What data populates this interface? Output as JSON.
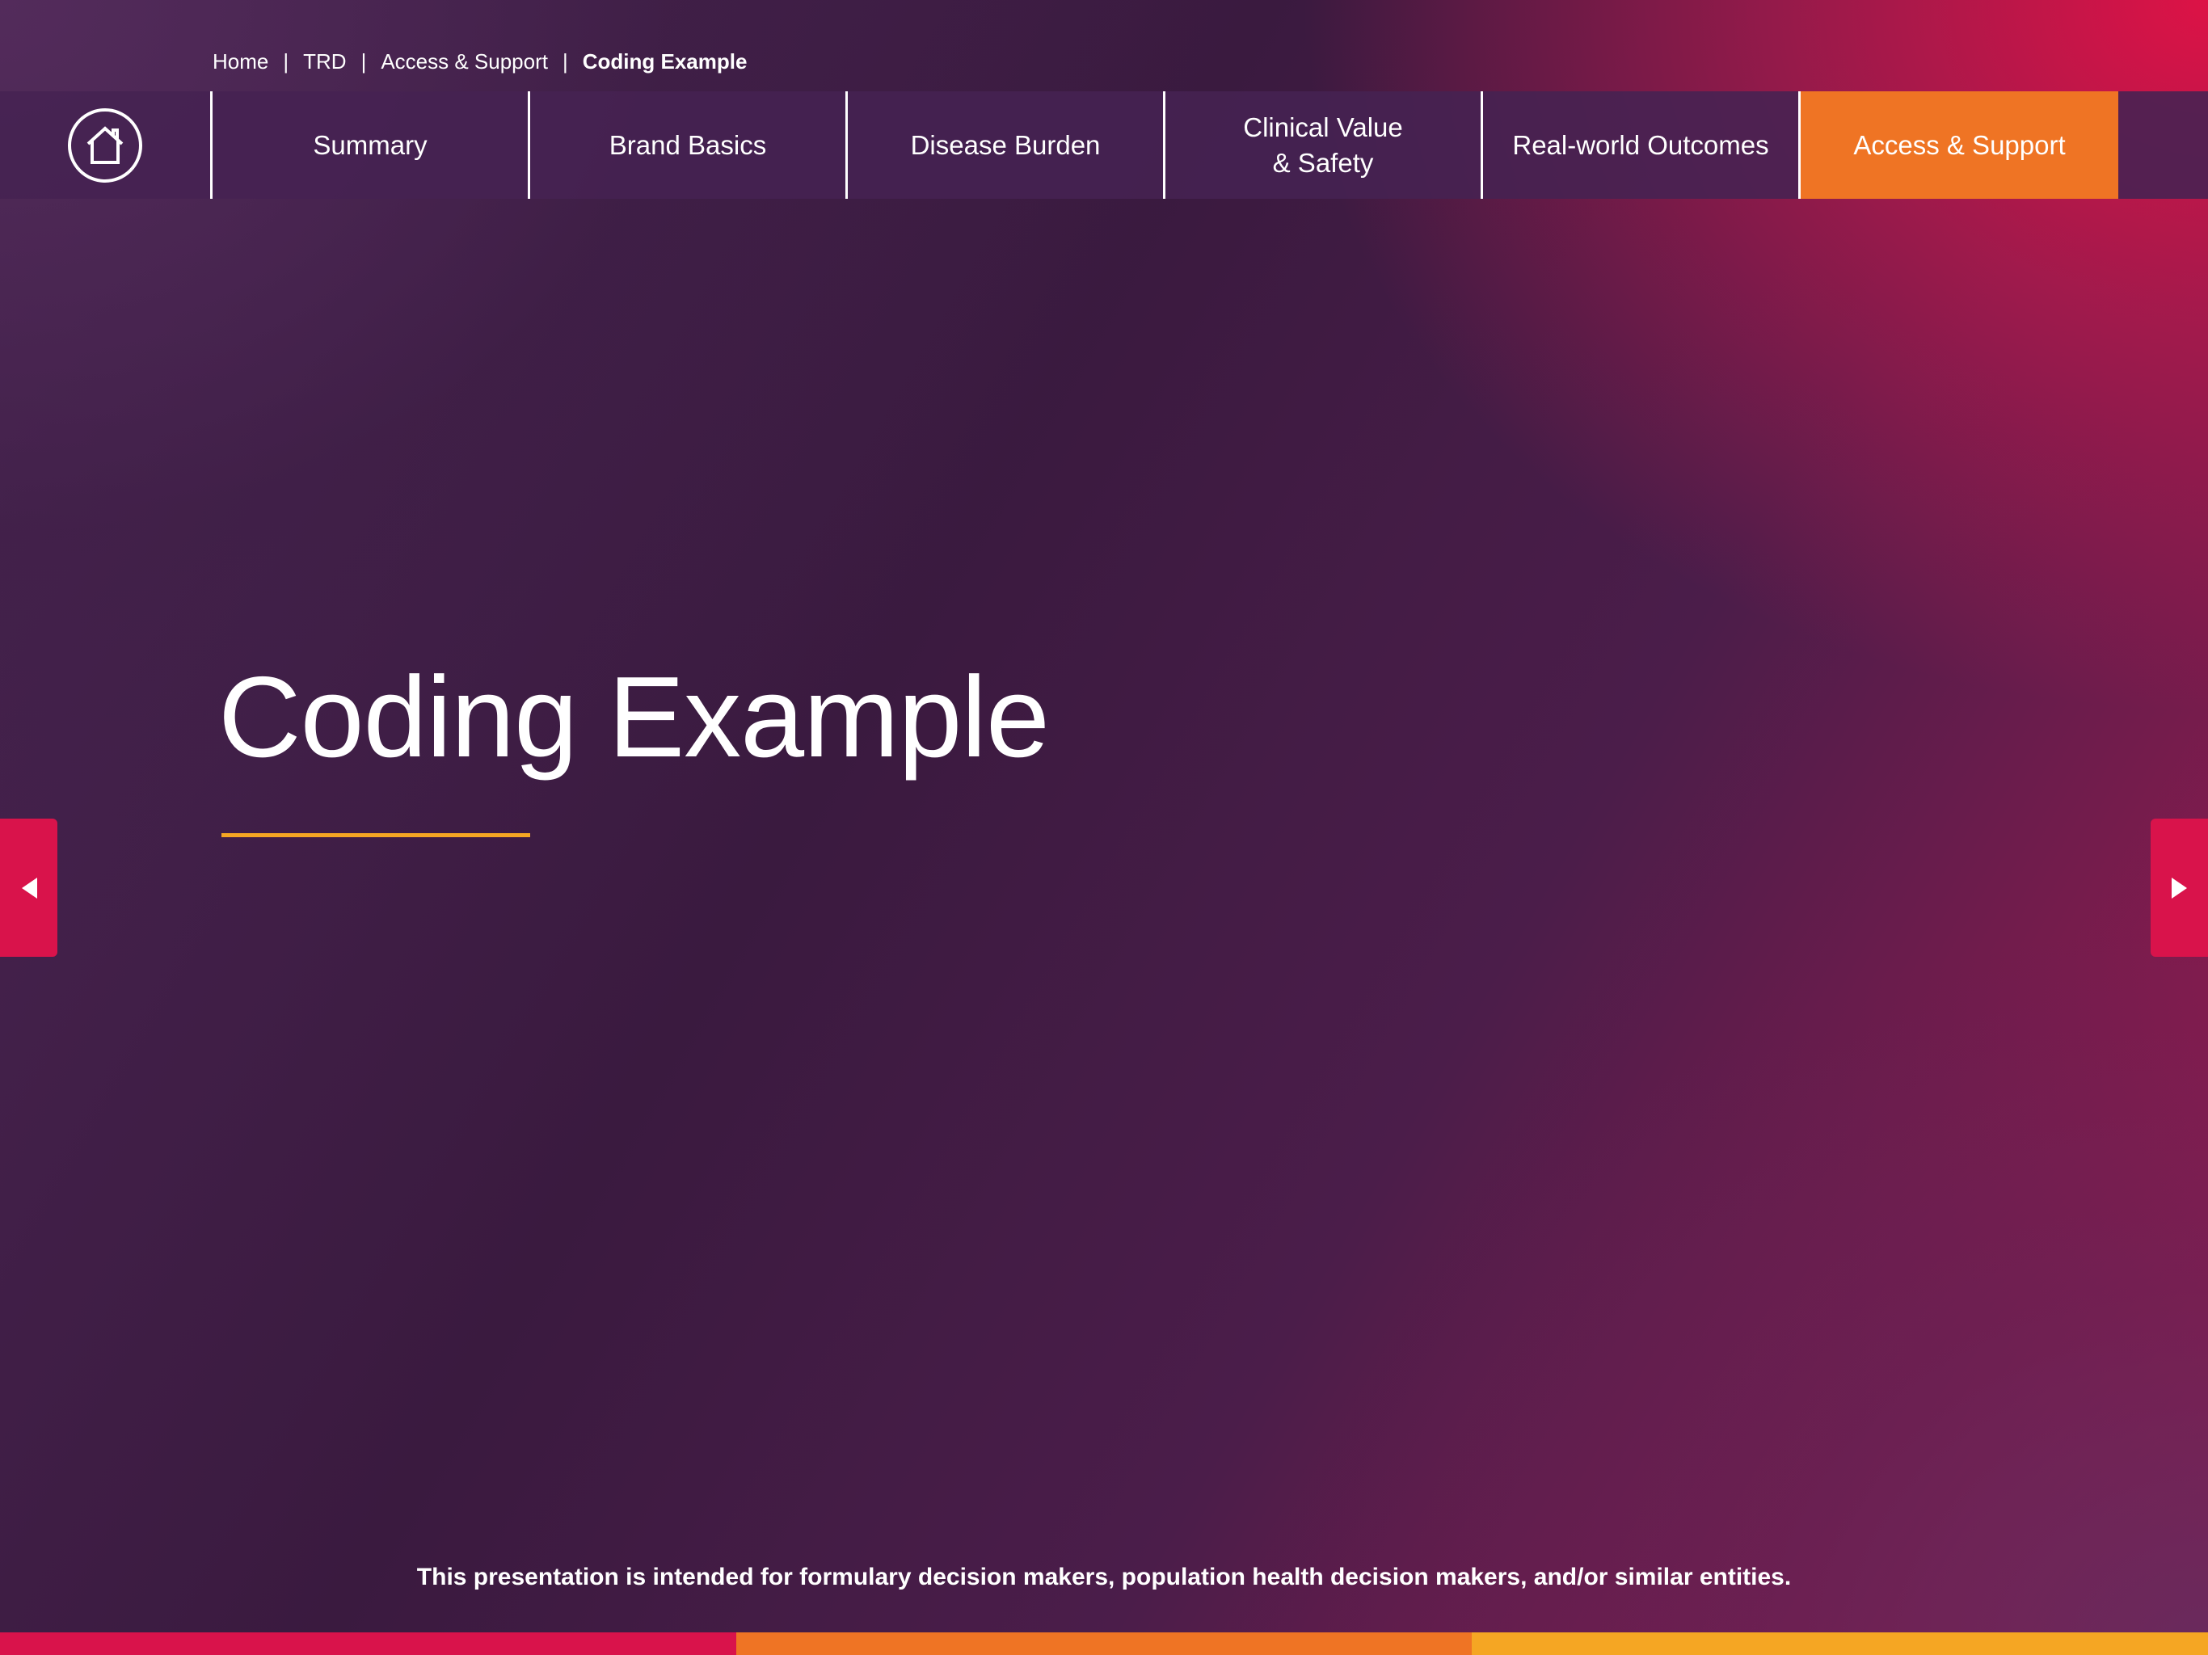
{
  "breadcrumb": {
    "items": [
      "Home",
      "TRD",
      "Access & Support"
    ],
    "separator": "|",
    "current": "Coding Example"
  },
  "nav": {
    "home_icon": "home-icon",
    "tabs": [
      {
        "label": "Summary",
        "active": false
      },
      {
        "label": "Brand Basics",
        "active": false
      },
      {
        "label": "Disease Burden",
        "active": false
      },
      {
        "label": "Clinical Value\n& Safety",
        "active": false
      },
      {
        "label": "Real-world Outcomes",
        "active": false
      },
      {
        "label": "Access & Support",
        "active": true
      }
    ]
  },
  "main": {
    "title": "Coding Example"
  },
  "arrows": {
    "prev_icon": "chevron-left-icon",
    "next_icon": "chevron-right-icon"
  },
  "footer": {
    "disclaimer": "This presentation is intended for formulary decision makers, population health decision makers, and/or similar entities."
  },
  "colors": {
    "accent_orange": "#ef7424",
    "accent_red": "#d9134b",
    "underline_gold": "#f5a623",
    "footer_segments": [
      "#d9134b",
      "#ef7424",
      "#f5a623"
    ]
  }
}
